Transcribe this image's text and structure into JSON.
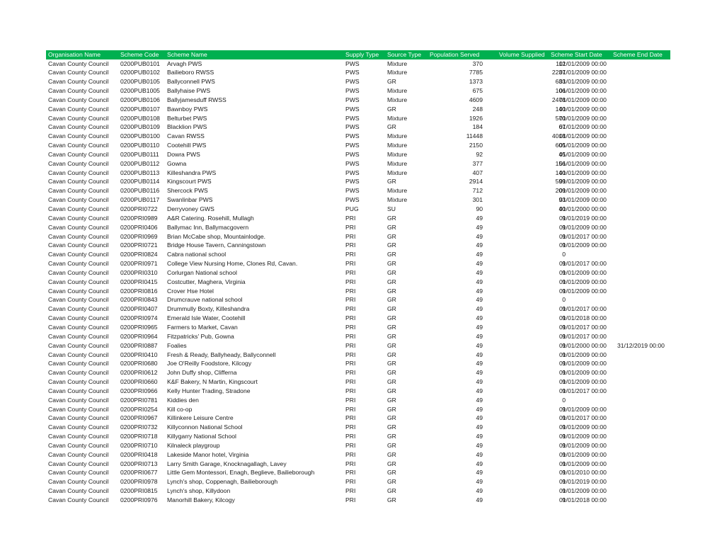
{
  "table": {
    "header_color": "#00b050",
    "columns": [
      "Organisation Name",
      "Scheme Code",
      "Scheme Name",
      "Supply Type",
      "Source Type",
      "Population Served",
      "Volume Supplied",
      "Scheme Start Date",
      "Scheme End Date"
    ],
    "rows": [
      [
        "Cavan County Council",
        "0200PUB0101",
        "Arvagh PWS",
        "PWS",
        "Mixture",
        "370",
        "112",
        "01/01/2009 00:00",
        ""
      ],
      [
        "Cavan County Council",
        "0200PUB0102",
        "Bailieboro RWSS",
        "PWS",
        "Mixture",
        "7785",
        "2237",
        "01/01/2009 00:00",
        ""
      ],
      [
        "Cavan County Council",
        "0200PUB0105",
        "Ballyconnell PWS",
        "PWS",
        "GR",
        "1373",
        "633",
        "01/01/2009 00:00",
        ""
      ],
      [
        "Cavan County Council",
        "0200PUB1005",
        "Ballyhaise PWS",
        "PWS",
        "Mixture",
        "675",
        "106",
        "01/01/2009 00:00",
        ""
      ],
      [
        "Cavan County Council",
        "0200PUB0106",
        "Ballyjamesduff RWSS",
        "PWS",
        "Mixture",
        "4609",
        "2478",
        "01/01/2009 00:00",
        ""
      ],
      [
        "Cavan County Council",
        "0200PUB0107",
        "Bawnboy PWS",
        "PWS",
        "GR",
        "248",
        "140",
        "01/01/2009 00:00",
        ""
      ],
      [
        "Cavan County Council",
        "0200PUB0108",
        "Belturbet PWS",
        "PWS",
        "Mixture",
        "1926",
        "570",
        "01/01/2009 00:00",
        ""
      ],
      [
        "Cavan County Council",
        "0200PUB0109",
        "Blacklion PWS",
        "PWS",
        "GR",
        "184",
        "67",
        "01/01/2009 00:00",
        ""
      ],
      [
        "Cavan County Council",
        "0200PUB0100",
        "Cavan RWSS",
        "PWS",
        "Mixture",
        "11448",
        "4018",
        "01/01/2009 00:00",
        ""
      ],
      [
        "Cavan County Council",
        "0200PUB0110",
        "Cootehill PWS",
        "PWS",
        "Mixture",
        "2150",
        "605",
        "01/01/2009 00:00",
        ""
      ],
      [
        "Cavan County Council",
        "0200PUB0111",
        "Dowra PWS",
        "PWS",
        "Mixture",
        "92",
        "45",
        "01/01/2009 00:00",
        ""
      ],
      [
        "Cavan County Council",
        "0200PUB0112",
        "Gowna",
        "PWS",
        "Mixture",
        "377",
        "156",
        "01/01/2009 00:00",
        ""
      ],
      [
        "Cavan County Council",
        "0200PUB0113",
        "Killeshandra PWS",
        "PWS",
        "Mixture",
        "407",
        "140",
        "01/01/2009 00:00",
        ""
      ],
      [
        "Cavan County Council",
        "0200PUB0114",
        "Kingscourt PWS",
        "PWS",
        "GR",
        "2914",
        "599",
        "01/01/2009 00:00",
        ""
      ],
      [
        "Cavan County Council",
        "0200PUB0116",
        "Shercock PWS",
        "PWS",
        "Mixture",
        "712",
        "209",
        "01/01/2009 00:00",
        ""
      ],
      [
        "Cavan County Council",
        "0200PUB0117",
        "Swanlinbar PWS",
        "PWS",
        "Mixture",
        "301",
        "93",
        "01/01/2009 00:00",
        ""
      ],
      [
        "Cavan County Council",
        "0200PRI0722",
        "Derryvoney GWS",
        "PUG",
        "SU",
        "90",
        "40",
        "01/01/2000 00:00",
        ""
      ],
      [
        "Cavan County Council",
        "0200PRI0989",
        "A&R Catering. Rosehill, Mullagh",
        "PRI",
        "GR",
        "49",
        "9",
        "01/01/2019 00:00",
        ""
      ],
      [
        "Cavan County Council",
        "0200PRI0406",
        "Ballymac Inn, Ballymacgovern",
        "PRI",
        "GR",
        "49",
        "9",
        "01/01/2009 00:00",
        ""
      ],
      [
        "Cavan County Council",
        "0200PRI0969",
        "Brian McCabe shop, Mountainlodge.",
        "PRI",
        "GR",
        "49",
        "9",
        "01/01/2017 00:00",
        ""
      ],
      [
        "Cavan County Council",
        "0200PRI0721",
        "Bridge House Tavern, Canningstown",
        "PRI",
        "GR",
        "49",
        "9",
        "01/01/2009 00:00",
        ""
      ],
      [
        "Cavan County Council",
        "0200PRI0824",
        "Cabra national school",
        "PRI",
        "GR",
        "49",
        "0",
        "",
        ""
      ],
      [
        "Cavan County Council",
        "0200PRI0971",
        "College View Nursing Home, Clones Rd, Cavan.",
        "PRI",
        "GR",
        "49",
        "9",
        "01/01/2017 00:00",
        ""
      ],
      [
        "Cavan County Council",
        "0200PRI0310",
        "Corlurgan National school",
        "PRI",
        "GR",
        "49",
        "9",
        "01/01/2009 00:00",
        ""
      ],
      [
        "Cavan County Council",
        "0200PRI0415",
        "Costcutter, Maghera, Virginia",
        "PRI",
        "GR",
        "49",
        "9",
        "01/01/2009 00:00",
        ""
      ],
      [
        "Cavan County Council",
        "0200PRI0816",
        "Crover Hse Hotel",
        "PRI",
        "GR",
        "49",
        "9",
        "01/01/2009 00:00",
        ""
      ],
      [
        "Cavan County Council",
        "0200PRI0843",
        "Drumcrauve national school",
        "PRI",
        "GR",
        "49",
        "0",
        "",
        ""
      ],
      [
        "Cavan County Council",
        "0200PRI0407",
        "Drummully Boxty, Killeshandra",
        "PRI",
        "GR",
        "49",
        "9",
        "01/01/2017 00:00",
        ""
      ],
      [
        "Cavan County Council",
        "0200PRI0974",
        "Emerald Isle Water, Cootehill",
        "PRI",
        "GR",
        "49",
        "9",
        "01/01/2018 00:00",
        ""
      ],
      [
        "Cavan County Council",
        "0200PRI0965",
        "Farmers to Market, Cavan",
        "PRI",
        "GR",
        "49",
        "9",
        "01/01/2017 00:00",
        ""
      ],
      [
        "Cavan County Council",
        "0200PRI0964",
        "Fitzpatricks' Pub, Gowna",
        "PRI",
        "GR",
        "49",
        "9",
        "01/01/2017 00:00",
        ""
      ],
      [
        "Cavan County Council",
        "0200PRI0887",
        "Foalies",
        "PRI",
        "GR",
        "49",
        "9",
        "01/01/2000 00:00",
        "31/12/2019 00:00"
      ],
      [
        "Cavan County Council",
        "0200PRI0410",
        "Fresh & Ready, Ballyheady, Ballyconnell",
        "PRI",
        "GR",
        "49",
        "9",
        "01/01/2009 00:00",
        ""
      ],
      [
        "Cavan County Council",
        "0200PRI0680",
        "Joe O'Reilly Foodstore, Kilcogy",
        "PRI",
        "GR",
        "49",
        "9",
        "01/01/2009 00:00",
        ""
      ],
      [
        "Cavan County Council",
        "0200PRI0612",
        "John Duffy shop, Clifferna",
        "PRI",
        "GR",
        "49",
        "9",
        "01/01/2009 00:00",
        ""
      ],
      [
        "Cavan County Council",
        "0200PRI0660",
        "K&F Bakery, N Martin, Kingscourt",
        "PRI",
        "GR",
        "49",
        "9",
        "01/01/2009 00:00",
        ""
      ],
      [
        "Cavan County Council",
        "0200PRI0966",
        "Kelly Hunter Trading, Stradone",
        "PRI",
        "GR",
        "49",
        "9",
        "01/01/2017 00:00",
        ""
      ],
      [
        "Cavan County Council",
        "0200PRI0781",
        "Kiddies den",
        "PRI",
        "GR",
        "49",
        "0",
        "",
        ""
      ],
      [
        "Cavan County Council",
        "0200PRI0254",
        "Kill co-op",
        "PRI",
        "GR",
        "49",
        "9",
        "01/01/2009 00:00",
        ""
      ],
      [
        "Cavan County Council",
        "0200PRI0967",
        "Killinkere Leisure Centre",
        "PRI",
        "GR",
        "49",
        "9",
        "01/01/2017 00:00",
        ""
      ],
      [
        "Cavan County Council",
        "0200PRI0732",
        "Killyconnon National School",
        "PRI",
        "GR",
        "49",
        "9",
        "01/01/2009 00:00",
        ""
      ],
      [
        "Cavan County Council",
        "0200PRI0718",
        "Killygarry National School",
        "PRI",
        "GR",
        "49",
        "9",
        "01/01/2009 00:00",
        ""
      ],
      [
        "Cavan County Council",
        "0200PRI0710",
        "Kilnaleck playgroup",
        "PRI",
        "GR",
        "49",
        "9",
        "01/01/2009 00:00",
        ""
      ],
      [
        "Cavan County Council",
        "0200PRI0418",
        "Lakeside Manor hotel, Virginia",
        "PRI",
        "GR",
        "49",
        "9",
        "01/01/2009 00:00",
        ""
      ],
      [
        "Cavan County Council",
        "0200PRI0713",
        "Larry Smith Garage, Knocknagallagh, Lavey",
        "PRI",
        "GR",
        "49",
        "9",
        "01/01/2009 00:00",
        ""
      ],
      [
        "Cavan County Council",
        "0200PRI0677",
        "Little Gem Montessori, Enagh, Beglieve, Bailieborough",
        "PRI",
        "GR",
        "49",
        "9",
        "01/01/2010 00:00",
        ""
      ],
      [
        "Cavan County Council",
        "0200PRI0978",
        "Lynch's shop, Coppenagh, Bailieborough",
        "PRI",
        "GR",
        "49",
        "9",
        "01/01/2019 00:00",
        ""
      ],
      [
        "Cavan County Council",
        "0200PRI0815",
        "Lynch's shop, Killydoon",
        "PRI",
        "GR",
        "49",
        "9",
        "01/01/2009 00:00",
        ""
      ],
      [
        "Cavan County Council",
        "0200PRI0976",
        "Manorhill Bakery, Kilcogy",
        "PRI",
        "GR",
        "49",
        "9",
        "01/01/2018 00:00",
        ""
      ]
    ]
  }
}
